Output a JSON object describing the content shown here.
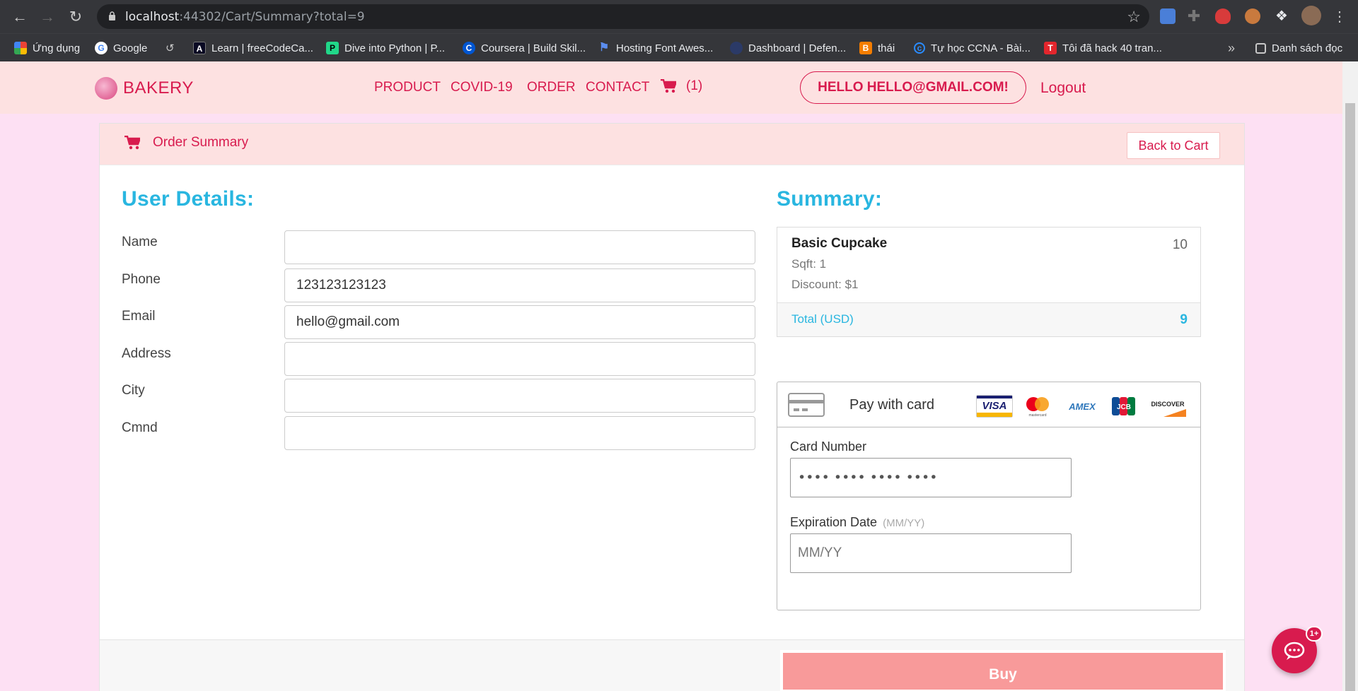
{
  "browser": {
    "url_host": "localhost",
    "url_rest": ":44302/Cart/Summary?total=9",
    "bookmarks": [
      {
        "label": "Ứng dụng",
        "icon": "apps-grid-icon"
      },
      {
        "label": "Google",
        "icon": "google-icon"
      },
      {
        "label": "Learn | freeCodeCa...",
        "icon": "freecodecamp-icon"
      },
      {
        "label": "Dive into Python | P...",
        "icon": "pycharm-icon"
      },
      {
        "label": "Coursera | Build Skil...",
        "icon": "coursera-icon"
      },
      {
        "label": "Hosting Font Awes...",
        "icon": "flag-icon"
      },
      {
        "label": "Dashboard | Defen...",
        "icon": "globe-icon"
      },
      {
        "label": "thái",
        "icon": "blogger-icon"
      },
      {
        "label": "Tự học CCNA - Bài...",
        "icon": "search-circle-icon"
      },
      {
        "label": "Tôi đã hack 40 tran...",
        "icon": "t-icon"
      }
    ],
    "reading_list": "Danh sách đọc"
  },
  "site": {
    "brand": "BAKERY",
    "nav": [
      "PRODUCT",
      "COVID-19",
      "ORDER",
      "CONTACT"
    ],
    "cart_count": "(1)",
    "greeting": "HELLO HELLO@GMAIL.COM!",
    "logout": "Logout"
  },
  "order": {
    "header_title": "Order Summary",
    "back_to_cart": "Back to Cart",
    "user_details_title": "User Details:",
    "fields": [
      {
        "label": "Name",
        "value": ""
      },
      {
        "label": "Phone",
        "value": "123123123123"
      },
      {
        "label": "Email",
        "value": "hello@gmail.com"
      },
      {
        "label": "Address",
        "value": ""
      },
      {
        "label": "City",
        "value": ""
      },
      {
        "label": "Cmnd",
        "value": ""
      }
    ],
    "summary_title": "Summary:",
    "item": {
      "name": "Basic Cupcake",
      "qty": "10",
      "sqft": "Sqft: 1",
      "discount": "Discount: $1"
    },
    "total_label": "Total (USD)",
    "total_value": "9",
    "payment": {
      "title": "Pay with card",
      "card_brands": [
        "VISA",
        "mastercard",
        "AMEX",
        "JCB",
        "DISCOVER"
      ],
      "card_number_label": "Card Number",
      "card_number_placeholder": "•••• •••• •••• ••••",
      "expiry_label": "Expiration Date",
      "expiry_hint": "(MM/YY)",
      "expiry_placeholder": "MM/YY"
    },
    "buy": "Buy"
  },
  "chat": {
    "badge": "1+"
  },
  "colors": {
    "brand": "#d81b4e",
    "accent": "#29b6e0",
    "page_bg": "#fde0f3",
    "header_bg": "#fde1e1",
    "buy_bg": "#f89a9a"
  }
}
